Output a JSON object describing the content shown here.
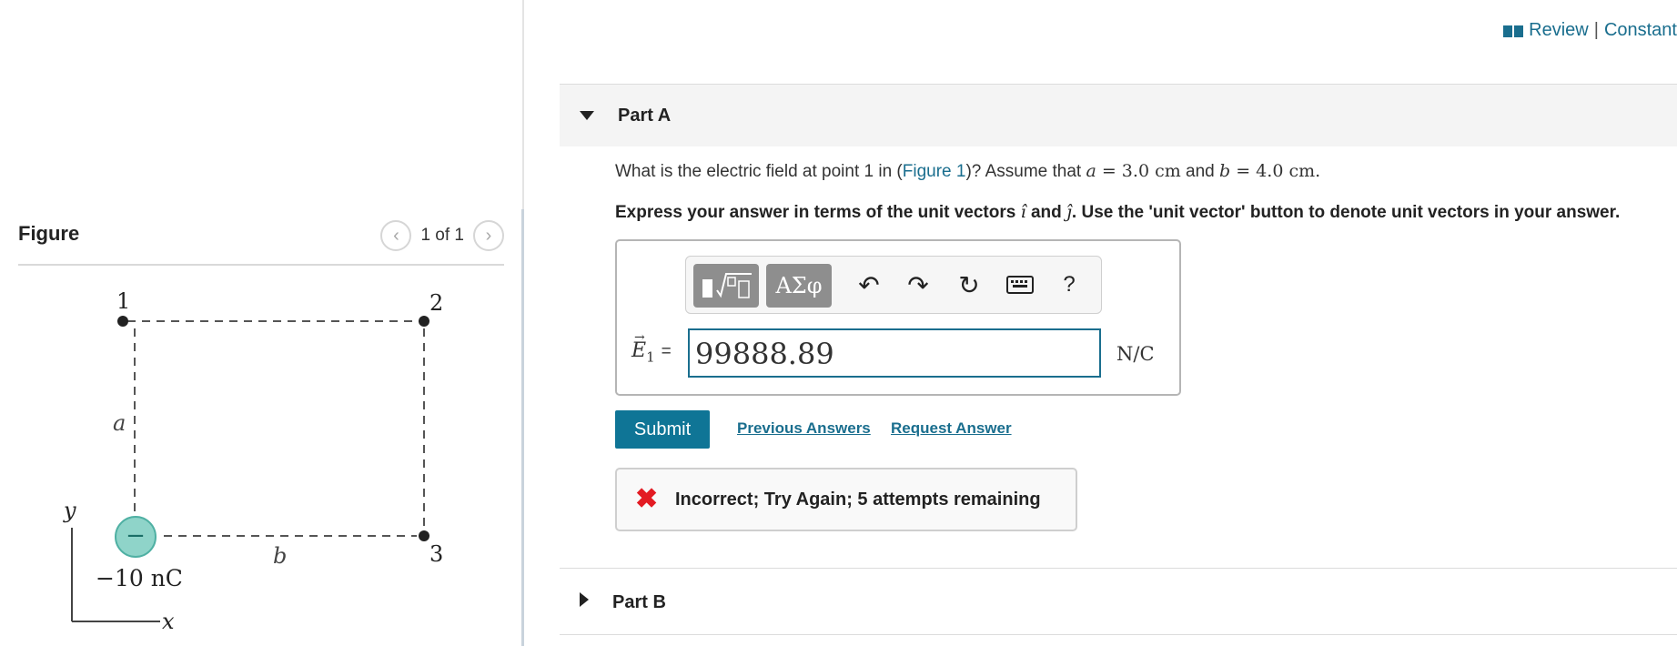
{
  "header": {
    "review_label": "Review",
    "separator": "|",
    "constants_label": "Constant"
  },
  "figure_panel": {
    "title": "Figure",
    "pager_text": "1 of 1",
    "prev_icon": "chevron-left-icon",
    "next_icon": "chevron-right-icon",
    "diagram": {
      "point_1": "1",
      "point_2": "2",
      "point_3": "3",
      "label_a": "a",
      "label_b": "b",
      "charge_label": "−10 nC",
      "charge_sign": "−",
      "axis_y": "y",
      "axis_x": "x",
      "charge_color": "#7fcfc4"
    }
  },
  "part_a": {
    "label": "Part A",
    "question_prefix": "What is the electric field at point 1 in (",
    "figure_link": "Figure 1",
    "question_mid": ")? Assume that ",
    "a_var": "a",
    "a_eq": " = 3.0 ",
    "a_unit": "cm",
    "and_word": " and ",
    "b_var": "b",
    "b_eq": " = 4.0 ",
    "b_unit": "cm",
    "period": ".",
    "instruction_prefix": "Express your answer in terms of the unit vectors ",
    "i_hat": "î",
    "instruction_and": " and ",
    "j_hat": "ĵ",
    "instruction_suffix": ". Use the 'unit vector' button to denote unit vectors in your answer.",
    "toolbar": {
      "templates_icon": "math-templates-icon",
      "greek_label": "ΑΣφ",
      "undo_icon": "undo-icon",
      "redo_icon": "redo-icon",
      "reset_icon": "reset-icon",
      "keyboard_icon": "keyboard-icon",
      "help_label": "?"
    },
    "equation_label": "E",
    "equation_subscript": "1",
    "equation_equals": "=",
    "answer_value": "99888.89",
    "unit": "N/C",
    "submit_label": "Submit",
    "previous_answers_label": "Previous Answers",
    "request_answer_label": "Request Answer",
    "feedback_text": "Incorrect; Try Again; 5 attempts remaining",
    "accent_color": "#0f7596",
    "error_color": "#e31b23"
  },
  "part_b": {
    "label": "Part B"
  }
}
